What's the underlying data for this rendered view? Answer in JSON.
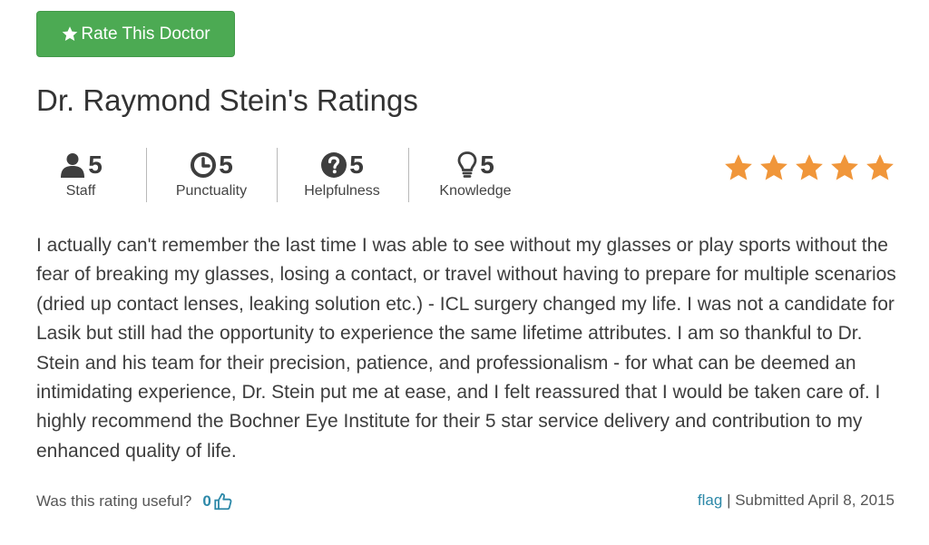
{
  "rate_button": {
    "label": "Rate This Doctor",
    "icon": "star-icon",
    "color": "#4caa53"
  },
  "page_title": "Dr. Raymond Stein's Ratings",
  "metrics": [
    {
      "icon": "user-icon",
      "value": "5",
      "label": "Staff"
    },
    {
      "icon": "clock-icon",
      "value": "5",
      "label": "Punctuality"
    },
    {
      "icon": "question-circle-icon",
      "value": "5",
      "label": "Helpfulness"
    },
    {
      "icon": "lightbulb-icon",
      "value": "5",
      "label": "Knowledge"
    }
  ],
  "overall_rating": {
    "stars": 5,
    "max": 5,
    "color": "#f0963a"
  },
  "review_text": "I actually can't remember the last time I was able to see without my glasses or play sports without the fear of breaking my glasses, losing a contact, or travel without having to prepare for multiple scenarios (dried up contact lenses, leaking solution etc.) - ICL surgery changed my life. I was not a candidate for Lasik but still had the opportunity to experience the same lifetime attributes. I am so thankful to Dr. Stein and his team for their precision, patience, and professionalism - for what can be deemed an intimidating experience, Dr. Stein put me at ease, and I felt reassured that I would be taken care of. I highly recommend the Bochner Eye Institute for their 5 star service delivery and contribution to my enhanced quality of life.",
  "footer": {
    "useful_question": "Was this rating useful?",
    "useful_count": "0",
    "useful_icon": "thumbs-up-icon",
    "flag_label": "flag",
    "separator": "|",
    "submitted": "Submitted April 8, 2015",
    "link_color": "#2c88a8"
  }
}
